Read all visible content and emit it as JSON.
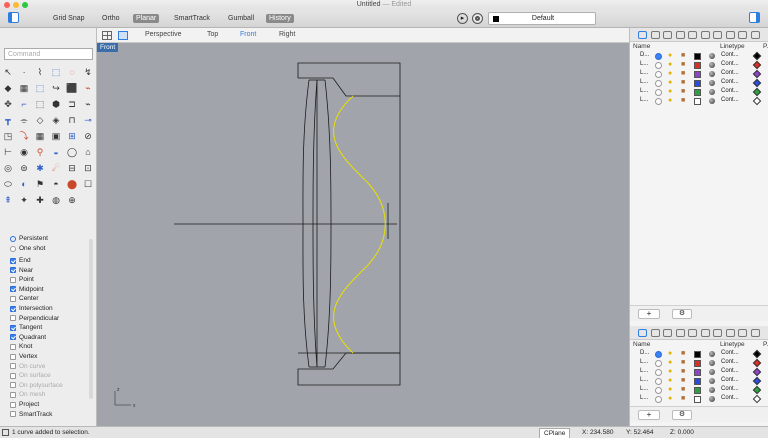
{
  "window": {
    "title": "Untitled",
    "edited": "— Edited"
  },
  "toolbar": {
    "items": [
      "Grid Snap",
      "Ortho",
      "Planar",
      "SmartTrack",
      "Gumball",
      "History"
    ],
    "active": [
      "Planar",
      "History"
    ],
    "layer_name": "Default"
  },
  "command": {
    "placeholder": "Command"
  },
  "viewport": {
    "tabs": [
      "Perspective",
      "Top",
      "Front",
      "Right"
    ],
    "active_tab": "Front",
    "label": "Front",
    "axis_z": "z",
    "axis_x": "x"
  },
  "osnaps": {
    "mode": [
      {
        "label": "Persistent",
        "on": true
      },
      {
        "label": "One shot",
        "on": false
      }
    ],
    "items": [
      {
        "label": "End",
        "on": true,
        "enabled": true
      },
      {
        "label": "Near",
        "on": true,
        "enabled": true
      },
      {
        "label": "Point",
        "on": false,
        "enabled": true
      },
      {
        "label": "Midpoint",
        "on": true,
        "enabled": true
      },
      {
        "label": "Center",
        "on": false,
        "enabled": true
      },
      {
        "label": "Intersection",
        "on": true,
        "enabled": true
      },
      {
        "label": "Perpendicular",
        "on": false,
        "enabled": true
      },
      {
        "label": "Tangent",
        "on": true,
        "enabled": true
      },
      {
        "label": "Quadrant",
        "on": true,
        "enabled": true
      },
      {
        "label": "Knot",
        "on": false,
        "enabled": true
      },
      {
        "label": "Vertex",
        "on": false,
        "enabled": true
      },
      {
        "label": "On curve",
        "on": false,
        "enabled": false
      },
      {
        "label": "On surface",
        "on": false,
        "enabled": false
      },
      {
        "label": "On polysurface",
        "on": false,
        "enabled": false
      },
      {
        "label": "On mesh",
        "on": false,
        "enabled": false
      },
      {
        "label": "Project",
        "on": false,
        "enabled": true
      },
      {
        "label": "SmartTrack",
        "on": false,
        "enabled": true
      }
    ]
  },
  "layers": {
    "col_name": "Name",
    "col_linetype": "Linetype",
    "col_p": "P...",
    "rows": [
      {
        "name": "D...",
        "color": "#000000",
        "linetype": "Cont...",
        "current": true
      },
      {
        "name": "L...",
        "color": "#d93025",
        "linetype": "Cont...",
        "current": false
      },
      {
        "name": "L...",
        "color": "#8e44c9",
        "linetype": "Cont...",
        "current": false
      },
      {
        "name": "L...",
        "color": "#2b4ed8",
        "linetype": "Cont...",
        "current": false
      },
      {
        "name": "L...",
        "color": "#2ea043",
        "linetype": "Cont...",
        "current": false
      },
      {
        "name": "L...",
        "color": "#ffffff",
        "linetype": "Cont...",
        "current": false
      }
    ]
  },
  "status": {
    "message": "1 curve added to selection.",
    "cplane": "CPlane",
    "x": "X: 234.580",
    "y": "Y: 52.464",
    "z": "Z: 0.000"
  }
}
